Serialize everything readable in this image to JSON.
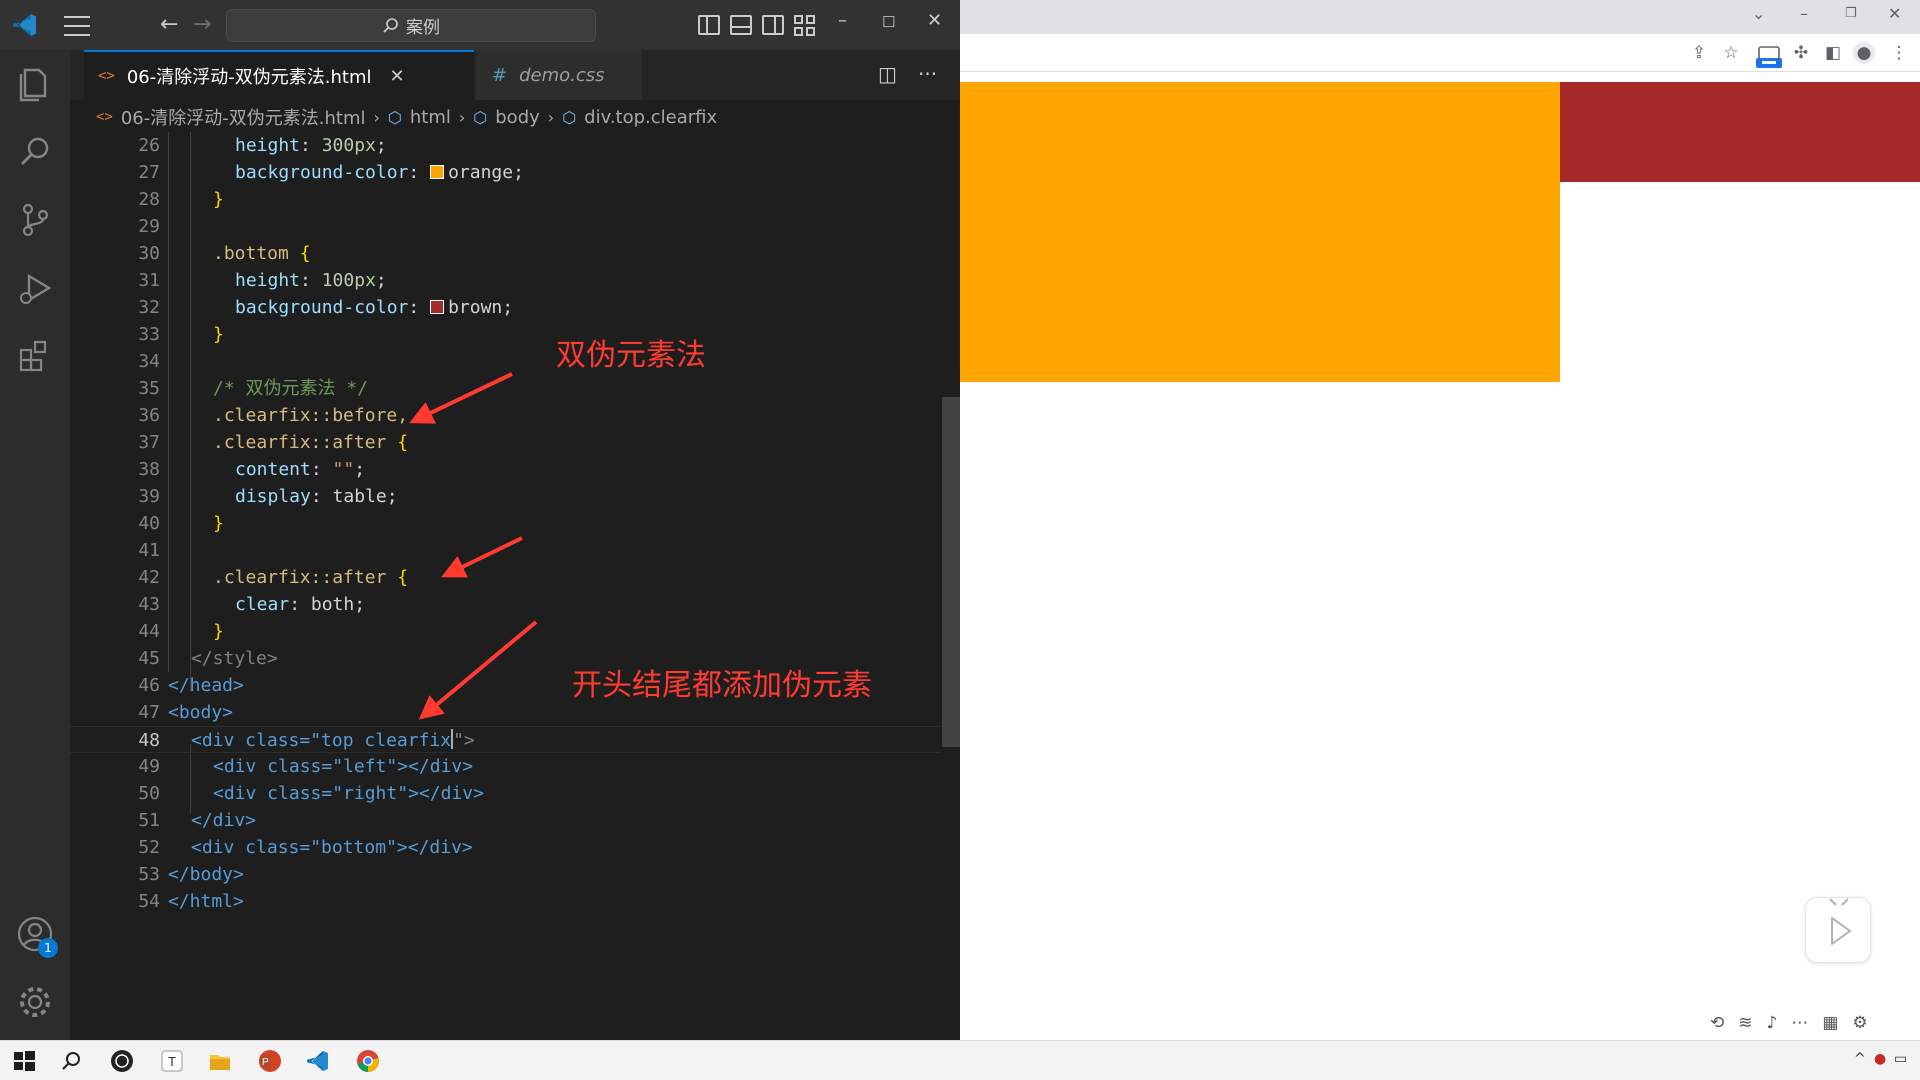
{
  "vscode": {
    "search_text": "案例",
    "tabs": [
      {
        "label": "06-清除浮动-双伪元素法.html",
        "icon": "html-file-icon",
        "active": true
      },
      {
        "label": "demo.css",
        "icon": "css-file-icon",
        "active": false
      }
    ],
    "breadcrumb": {
      "file": "06-清除浮动-双伪元素法.html",
      "items": [
        "html",
        "body",
        "div.top.clearfix"
      ]
    },
    "account_badge": "1",
    "colors": {
      "accent": "#0078d4",
      "editor_bg": "#1e1e1e",
      "annotation": "#ff3b30"
    },
    "code": {
      "current_line": "48",
      "lines": [
        {
          "n": "26",
          "t": ""
        },
        {
          "n": "27",
          "t": ""
        },
        {
          "n": "28",
          "t": "}"
        },
        {
          "n": "29",
          "t": ""
        },
        {
          "n": "30",
          "t": ""
        },
        {
          "n": "31",
          "t": ""
        },
        {
          "n": "32",
          "t": ""
        },
        {
          "n": "33",
          "t": "}"
        },
        {
          "n": "34",
          "t": ""
        },
        {
          "n": "35",
          "t": "/* 双伪元素法 */"
        },
        {
          "n": "36",
          "t": ".clearfix::before,"
        },
        {
          "n": "37",
          "t": ""
        },
        {
          "n": "38",
          "t": ""
        },
        {
          "n": "39",
          "t": ""
        },
        {
          "n": "40",
          "t": "}"
        },
        {
          "n": "41",
          "t": ""
        },
        {
          "n": "42",
          "t": ""
        },
        {
          "n": "43",
          "t": ""
        },
        {
          "n": "44",
          "t": "}"
        },
        {
          "n": "45",
          "t": ""
        },
        {
          "n": "46",
          "t": ""
        },
        {
          "n": "47",
          "t": ""
        },
        {
          "n": "48",
          "t": ""
        },
        {
          "n": "49",
          "t": ""
        },
        {
          "n": "50",
          "t": ""
        },
        {
          "n": "51",
          "t": ""
        },
        {
          "n": "52",
          "t": ""
        },
        {
          "n": "53",
          "t": ""
        },
        {
          "n": "54",
          "t": ""
        }
      ],
      "tokens": {
        "height": "height",
        "bgcolor": "background-color",
        "v300": "300px",
        "v100": "100px",
        "orange": "orange",
        "brown": "brown",
        "bottom_sel": ".bottom",
        "after_sel": ".clearfix::after",
        "content": "content",
        "empty_str": "\"\"",
        "display": "display",
        "table": "table",
        "clear": "clear",
        "both": "both",
        "style_close": "</style>",
        "head_close": "</head>",
        "body_open": "<body>",
        "div_top_open": "<div class=\"top clearfix",
        "div_top_end": "\">",
        "div_left": "<div class=\"left\"></div>",
        "div_right": "<div class=\"right\"></div>",
        "div_close": "</div>",
        "div_bottom": "<div class=\"bottom\"></div>",
        "body_close": "</body>",
        "html_close": "</html>"
      }
    },
    "annotations": [
      "双伪元素法",
      "开头结尾都添加伪元素"
    ]
  },
  "browser": {
    "boxes": [
      {
        "name": "left",
        "color": "#ffa500"
      },
      {
        "name": "right",
        "color": "#a52a2a"
      }
    ]
  }
}
